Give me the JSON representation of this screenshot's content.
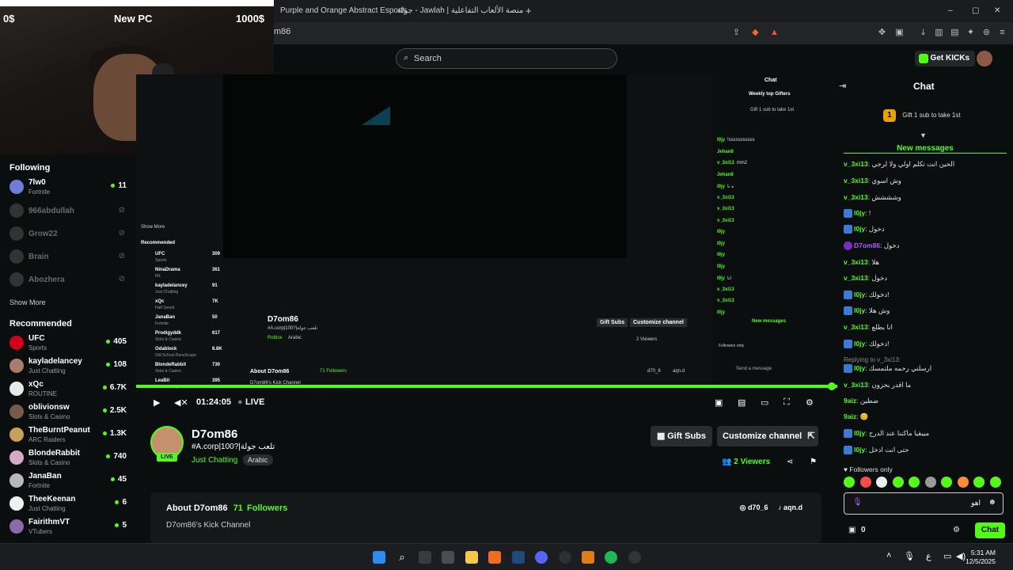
{
  "browser": {
    "tabs": [
      "Purple and Orange Abstract Esports",
      "جولة - Jawlah | منصة الألعاب التفاعلية"
    ],
    "url": "m86",
    "new_tab": "+",
    "window_controls": [
      "–",
      "▢",
      "✕"
    ]
  },
  "webcam": {
    "left_text": "0$",
    "center_text": "New PC",
    "right_text": "1000$"
  },
  "topbar": {
    "search_placeholder": "Search",
    "get_kicks": "Get KICKs"
  },
  "sidebar": {
    "following_title": "Following",
    "following": [
      {
        "name": "7lw0",
        "category": "Fortnite",
        "viewers": "11",
        "online": true
      },
      {
        "name": "966abdullah",
        "online": false
      },
      {
        "name": "Grow22",
        "online": false
      },
      {
        "name": "Brain",
        "online": false
      },
      {
        "name": "Abozhera",
        "online": false
      }
    ],
    "show_more_1": "Show More",
    "recommended_title": "Recommended",
    "recommended": [
      {
        "name": "UFC",
        "category": "Sports",
        "viewers": "405"
      },
      {
        "name": "kayladelancey",
        "category": "Just Chatting",
        "viewers": "108"
      },
      {
        "name": "xQc",
        "category": "ROUTINE",
        "viewers": "6.7K"
      },
      {
        "name": "oblivionsw",
        "category": "Slots & Casino",
        "viewers": "2.5K"
      },
      {
        "name": "TheBurntPeanut",
        "category": "ARC Raiders",
        "viewers": "1.3K"
      },
      {
        "name": "BlondeRabbit",
        "category": "Slots & Casino",
        "viewers": "740"
      },
      {
        "name": "JanaBan",
        "category": "Fortnite",
        "viewers": "45"
      },
      {
        "name": "TheeKeenan",
        "category": "Just Chatting",
        "viewers": "6"
      },
      {
        "name": "FairithmVT",
        "category": "VTubers",
        "viewers": "5"
      }
    ]
  },
  "player": {
    "time": "01:24:05",
    "live": "LIVE",
    "progress_percent": 100
  },
  "channel": {
    "name": "D7om86",
    "title": "#A.corp|100?|تلعب جولة",
    "category": "Just Chatting",
    "tag": "Arabic",
    "live_badge": "LIVE",
    "gift_subs": "Gift Subs",
    "customize": "Customize channel",
    "viewers_count": "2",
    "viewers_label": "Viewers",
    "about_title": "About D7om86",
    "followers_count": "71",
    "followers_label": "Followers",
    "about_desc": "D7om86's Kick Channel",
    "social_1": "d70_6",
    "social_2": "aqn.d"
  },
  "nested": {
    "chat_label": "Chat",
    "weekly_gifters": "Weekly top Gifters",
    "gift_line": "Gift 1 sub to take 1st",
    "new_messages": "New messages",
    "send_placeholder": "Send a message",
    "followers_only": "Followers only",
    "recommended": "Recommended",
    "show_more": "Show More",
    "channel_name": "D7om86",
    "channel_title": "#A.corp|100?|تلعب جولة",
    "channel_cat": "Roblox",
    "tag": "Arabic",
    "gift_subs": "Gift Subs",
    "customize": "Customize channel",
    "viewers": "2 Viewers",
    "about": "About D7om86",
    "followers": "71 Followers",
    "kick_channel": "D7om86's Kick Channel",
    "social_1": "d70_6",
    "social_2": "aqn.d",
    "sidebar": [
      {
        "name": "UFC",
        "cat": "Sports",
        "v": "309"
      },
      {
        "name": "NinaDrama",
        "cat": "IRL",
        "v": "361"
      },
      {
        "name": "kayladelancey",
        "cat": "Just Chatting",
        "v": "91"
      },
      {
        "name": "xQc",
        "cat": "Half Sword",
        "v": "7K"
      },
      {
        "name": "JanaBan",
        "cat": "Fortnite",
        "v": "50"
      },
      {
        "name": "Prodigyddk",
        "cat": "Slots & Casino",
        "v": "617"
      },
      {
        "name": "Odablock",
        "cat": "Old School RuneScape",
        "v": "8.8K"
      },
      {
        "name": "BlondeRabbit",
        "cat": "Slots & Casino",
        "v": "730"
      },
      {
        "name": "LeaBit",
        "cat": "Just Chatting",
        "v": "395"
      }
    ],
    "chat": [
      {
        "u": "l0jy",
        "t": "!sssssssssss"
      },
      {
        "u": "Jehan8",
        "t": ""
      },
      {
        "u": "v_3xi13",
        "t": "mm2"
      },
      {
        "u": "Jehan8",
        "t": ""
      },
      {
        "u": "l0jy",
        "t": "ه نا"
      },
      {
        "u": "v_3xi13",
        "t": ""
      },
      {
        "u": "v_3xi13",
        "t": ""
      },
      {
        "u": "v_3xi13",
        "t": ""
      },
      {
        "u": "l0jy",
        "t": ""
      },
      {
        "u": "l0jy",
        "t": ""
      },
      {
        "u": "l0jy",
        "t": ""
      },
      {
        "u": "l0jy",
        "t": ""
      },
      {
        "u": "l0jy",
        "t": "انا"
      },
      {
        "u": "v_3xi13",
        "t": ""
      },
      {
        "u": "v_3xi13",
        "t": ""
      },
      {
        "u": "l0jy",
        "t": ""
      }
    ]
  },
  "chat": {
    "title": "Chat",
    "gift_rank": "1",
    "gift_line": "Gift 1 sub to take 1st",
    "new_messages": "New messages",
    "messages": [
      {
        "user": "v_3xi13",
        "text": "الحين انت تكلم اولي ولا لرجي",
        "color": "#53fc18",
        "icon": ""
      },
      {
        "user": "v_3xi13",
        "text": "وش اسوي",
        "color": "#53fc18",
        "icon": ""
      },
      {
        "user": "v_3xi13",
        "text": "وشششش",
        "color": "#53fc18",
        "icon": ""
      },
      {
        "user": "l0jy",
        "text": "!",
        "color": "#53fc18",
        "icon": "b"
      },
      {
        "user": "l0jy",
        "text": "دخول",
        "color": "#53fc18",
        "icon": "b"
      },
      {
        "user": "D7om86",
        "text": "دخول",
        "color": "#b05cff",
        "icon": "p"
      },
      {
        "user": "v_3xi13",
        "text": "هلا",
        "color": "#53fc18",
        "icon": ""
      },
      {
        "user": "v_3xi13",
        "text": "دخول",
        "color": "#53fc18",
        "icon": ""
      },
      {
        "user": "l0jy",
        "text": "دخولك!",
        "color": "#53fc18",
        "icon": "b"
      },
      {
        "user": "l0jy",
        "text": "وش هلا",
        "color": "#53fc18",
        "icon": "b"
      },
      {
        "user": "v_3xi13",
        "text": "انا بطلع",
        "color": "#53fc18",
        "icon": ""
      },
      {
        "user": "l0jy",
        "text": "دخولك!",
        "color": "#53fc18",
        "icon": "b"
      },
      {
        "user": "l0jy",
        "text": "ارسلني رحمه ملتمسك",
        "color": "#53fc18",
        "icon": "b"
      },
      {
        "user": "v_3xi13",
        "text": "ما اقدر بحزون",
        "color": "#53fc18",
        "icon": ""
      },
      {
        "user": "9aiz",
        "text": "ضطين",
        "color": "#53fc18",
        "icon": ""
      },
      {
        "user": "9aiz",
        "text": "😊",
        "color": "#53fc18",
        "icon": ""
      },
      {
        "user": "l0jy",
        "text": "ميبقيا ماكننا عند الدرج",
        "color": "#53fc18",
        "icon": "b"
      },
      {
        "user": "l0jy",
        "text": "حتى انت ادخل",
        "color": "#53fc18",
        "icon": "b"
      }
    ],
    "replying_to": "Replying to v_3xi13:",
    "followers_only": "Followers only",
    "input_text": "اهو",
    "bottom_count": "0",
    "send_button": "Chat"
  },
  "taskbar": {
    "time": "5:31 AM",
    "date": "12/5/2025"
  },
  "colors": {
    "accent": "#53fc18",
    "background": "#0b0e0f",
    "panel": "#151819"
  }
}
